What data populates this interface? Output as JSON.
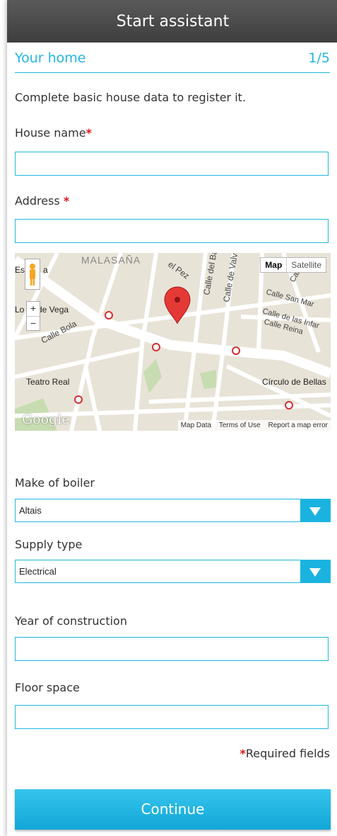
{
  "header": {
    "title": "Start assistant"
  },
  "section": {
    "title": "Your home",
    "step": "1/5"
  },
  "intro": "Complete basic house data to register it.",
  "fields": {
    "house_name": {
      "label": "House name",
      "value": ""
    },
    "address": {
      "label": "Address ",
      "value": ""
    },
    "boiler": {
      "label": "Make of boiler",
      "selected": "Altais"
    },
    "supply": {
      "label": "Supply type",
      "selected": "Electrical"
    },
    "year": {
      "label": "Year of construction",
      "value": ""
    },
    "floor": {
      "label": "Floor space",
      "value": ""
    }
  },
  "required_star": "*",
  "map": {
    "toggle_map": "Map",
    "toggle_satellite": "Satellite",
    "zoom_in": "+",
    "zoom_out": "−",
    "labels": [
      "MALASAÑA",
      "Calle del Barco",
      "Calle de Valverde",
      "Calle San Mar",
      "Calle de las Infar",
      "Calle Reina",
      "Calle Bola",
      "Teatro Real",
      "Círculo de Bellas",
      "Lo",
      "de Vega",
      "Esp",
      "a",
      "el Pez",
      "Calle"
    ],
    "footer": [
      "Map Data",
      "Terms of Use",
      "Report a map error"
    ],
    "logo": "Google",
    "colors": {
      "road": "#ffffff",
      "land": "#e8e3d7",
      "park": "#c8dcb1",
      "marker": "#e53935"
    }
  },
  "required_note": "Required fields",
  "continue_label": "Continue",
  "colors": {
    "accent": "#22b7e0",
    "header": "#4a4a4a",
    "required": "#e0151c"
  }
}
